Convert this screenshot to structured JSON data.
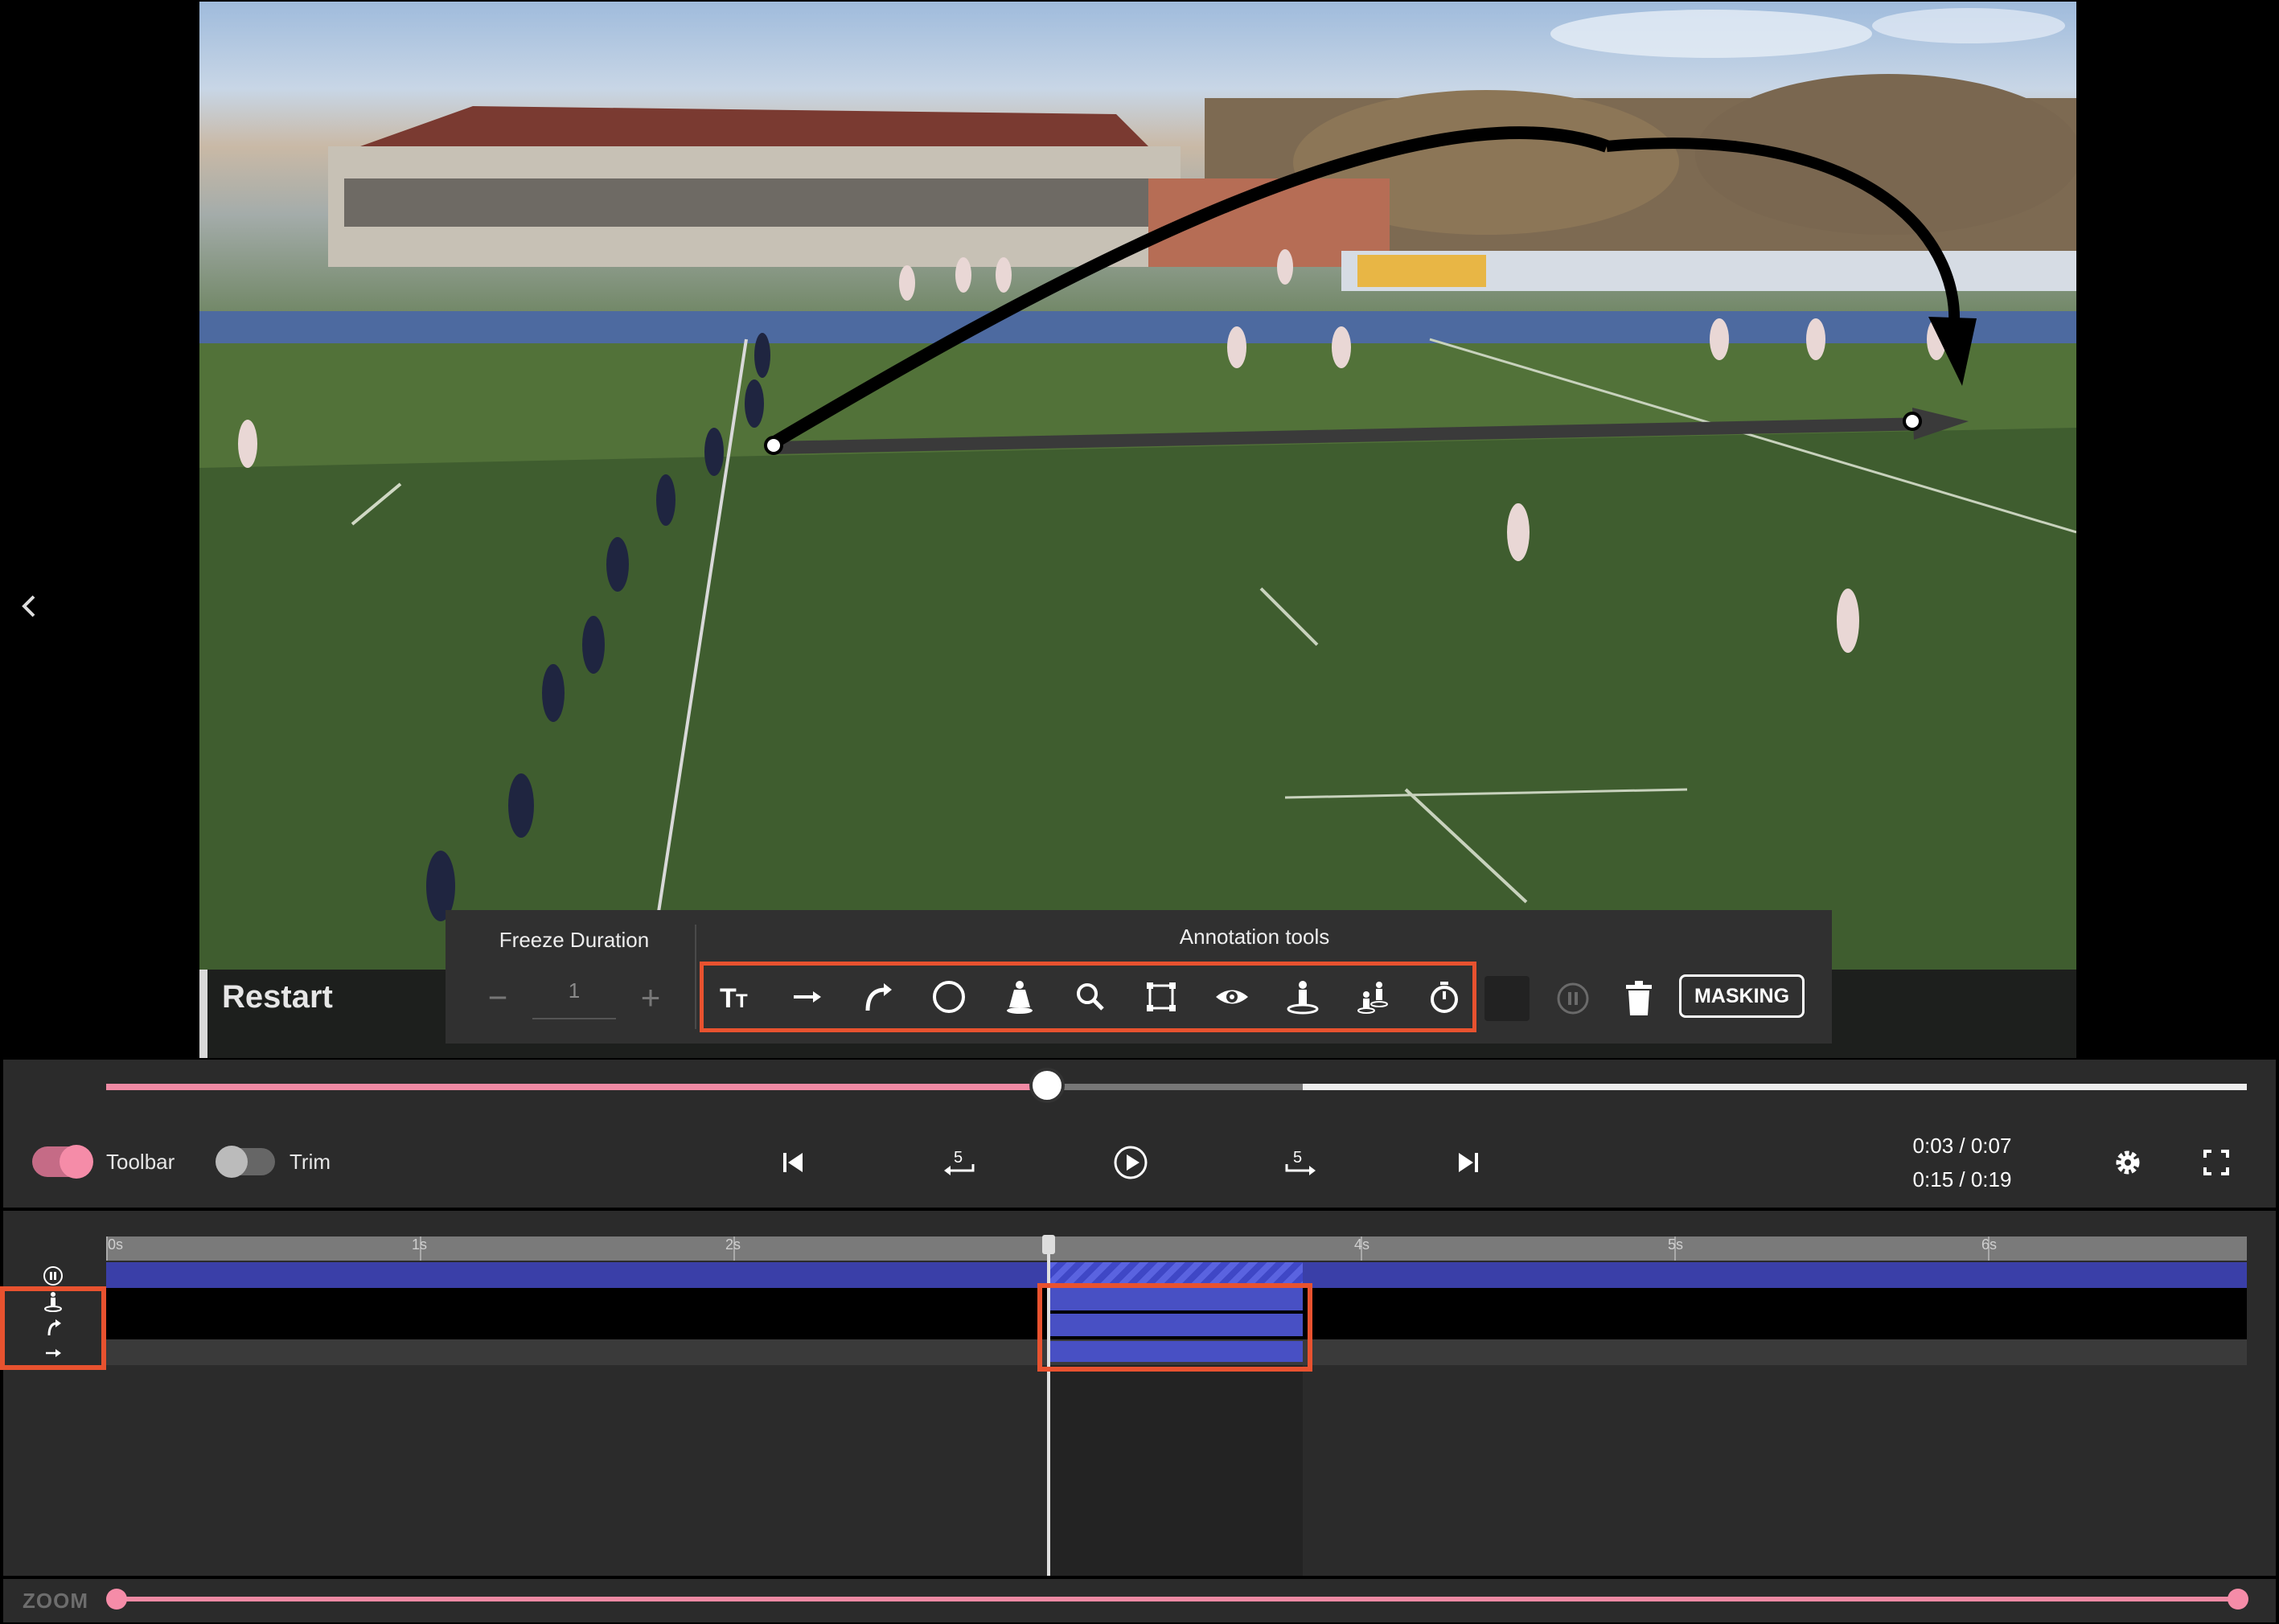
{
  "video": {
    "restart_label": "Restart",
    "back_icon": "chevron-left-icon"
  },
  "freeze": {
    "title": "Freeze Duration",
    "minus": "−",
    "value": "1",
    "plus": "+"
  },
  "annotation_tools": {
    "title": "Annotation tools",
    "tools": [
      "text-tool-icon",
      "arrow-tool-icon",
      "curved-arrow-tool-icon",
      "circle-tool-icon",
      "spotlight-tool-icon",
      "magnifier-tool-icon",
      "polygon-tool-icon",
      "visibility-tool-icon",
      "player-marker-tool-icon",
      "player-link-tool-icon",
      "timer-tool-icon"
    ],
    "masking_label": "MASKING"
  },
  "controls": {
    "toolbar_label": "Toolbar",
    "trim_label": "Trim",
    "skip_back": "5",
    "skip_forward": "5",
    "time_clip": "0:03 / 0:07",
    "time_total": "0:15 / 0:19",
    "seek_progress": 0.44
  },
  "timeline": {
    "ticks": [
      "0s",
      "1s",
      "2s",
      "4s",
      "5s",
      "6s"
    ]
  },
  "zoom": {
    "label": "ZOOM"
  },
  "colors": {
    "accent_pink": "#f08aa4",
    "highlight_orange": "#e8522f",
    "segment_blue": "#4850c4"
  }
}
